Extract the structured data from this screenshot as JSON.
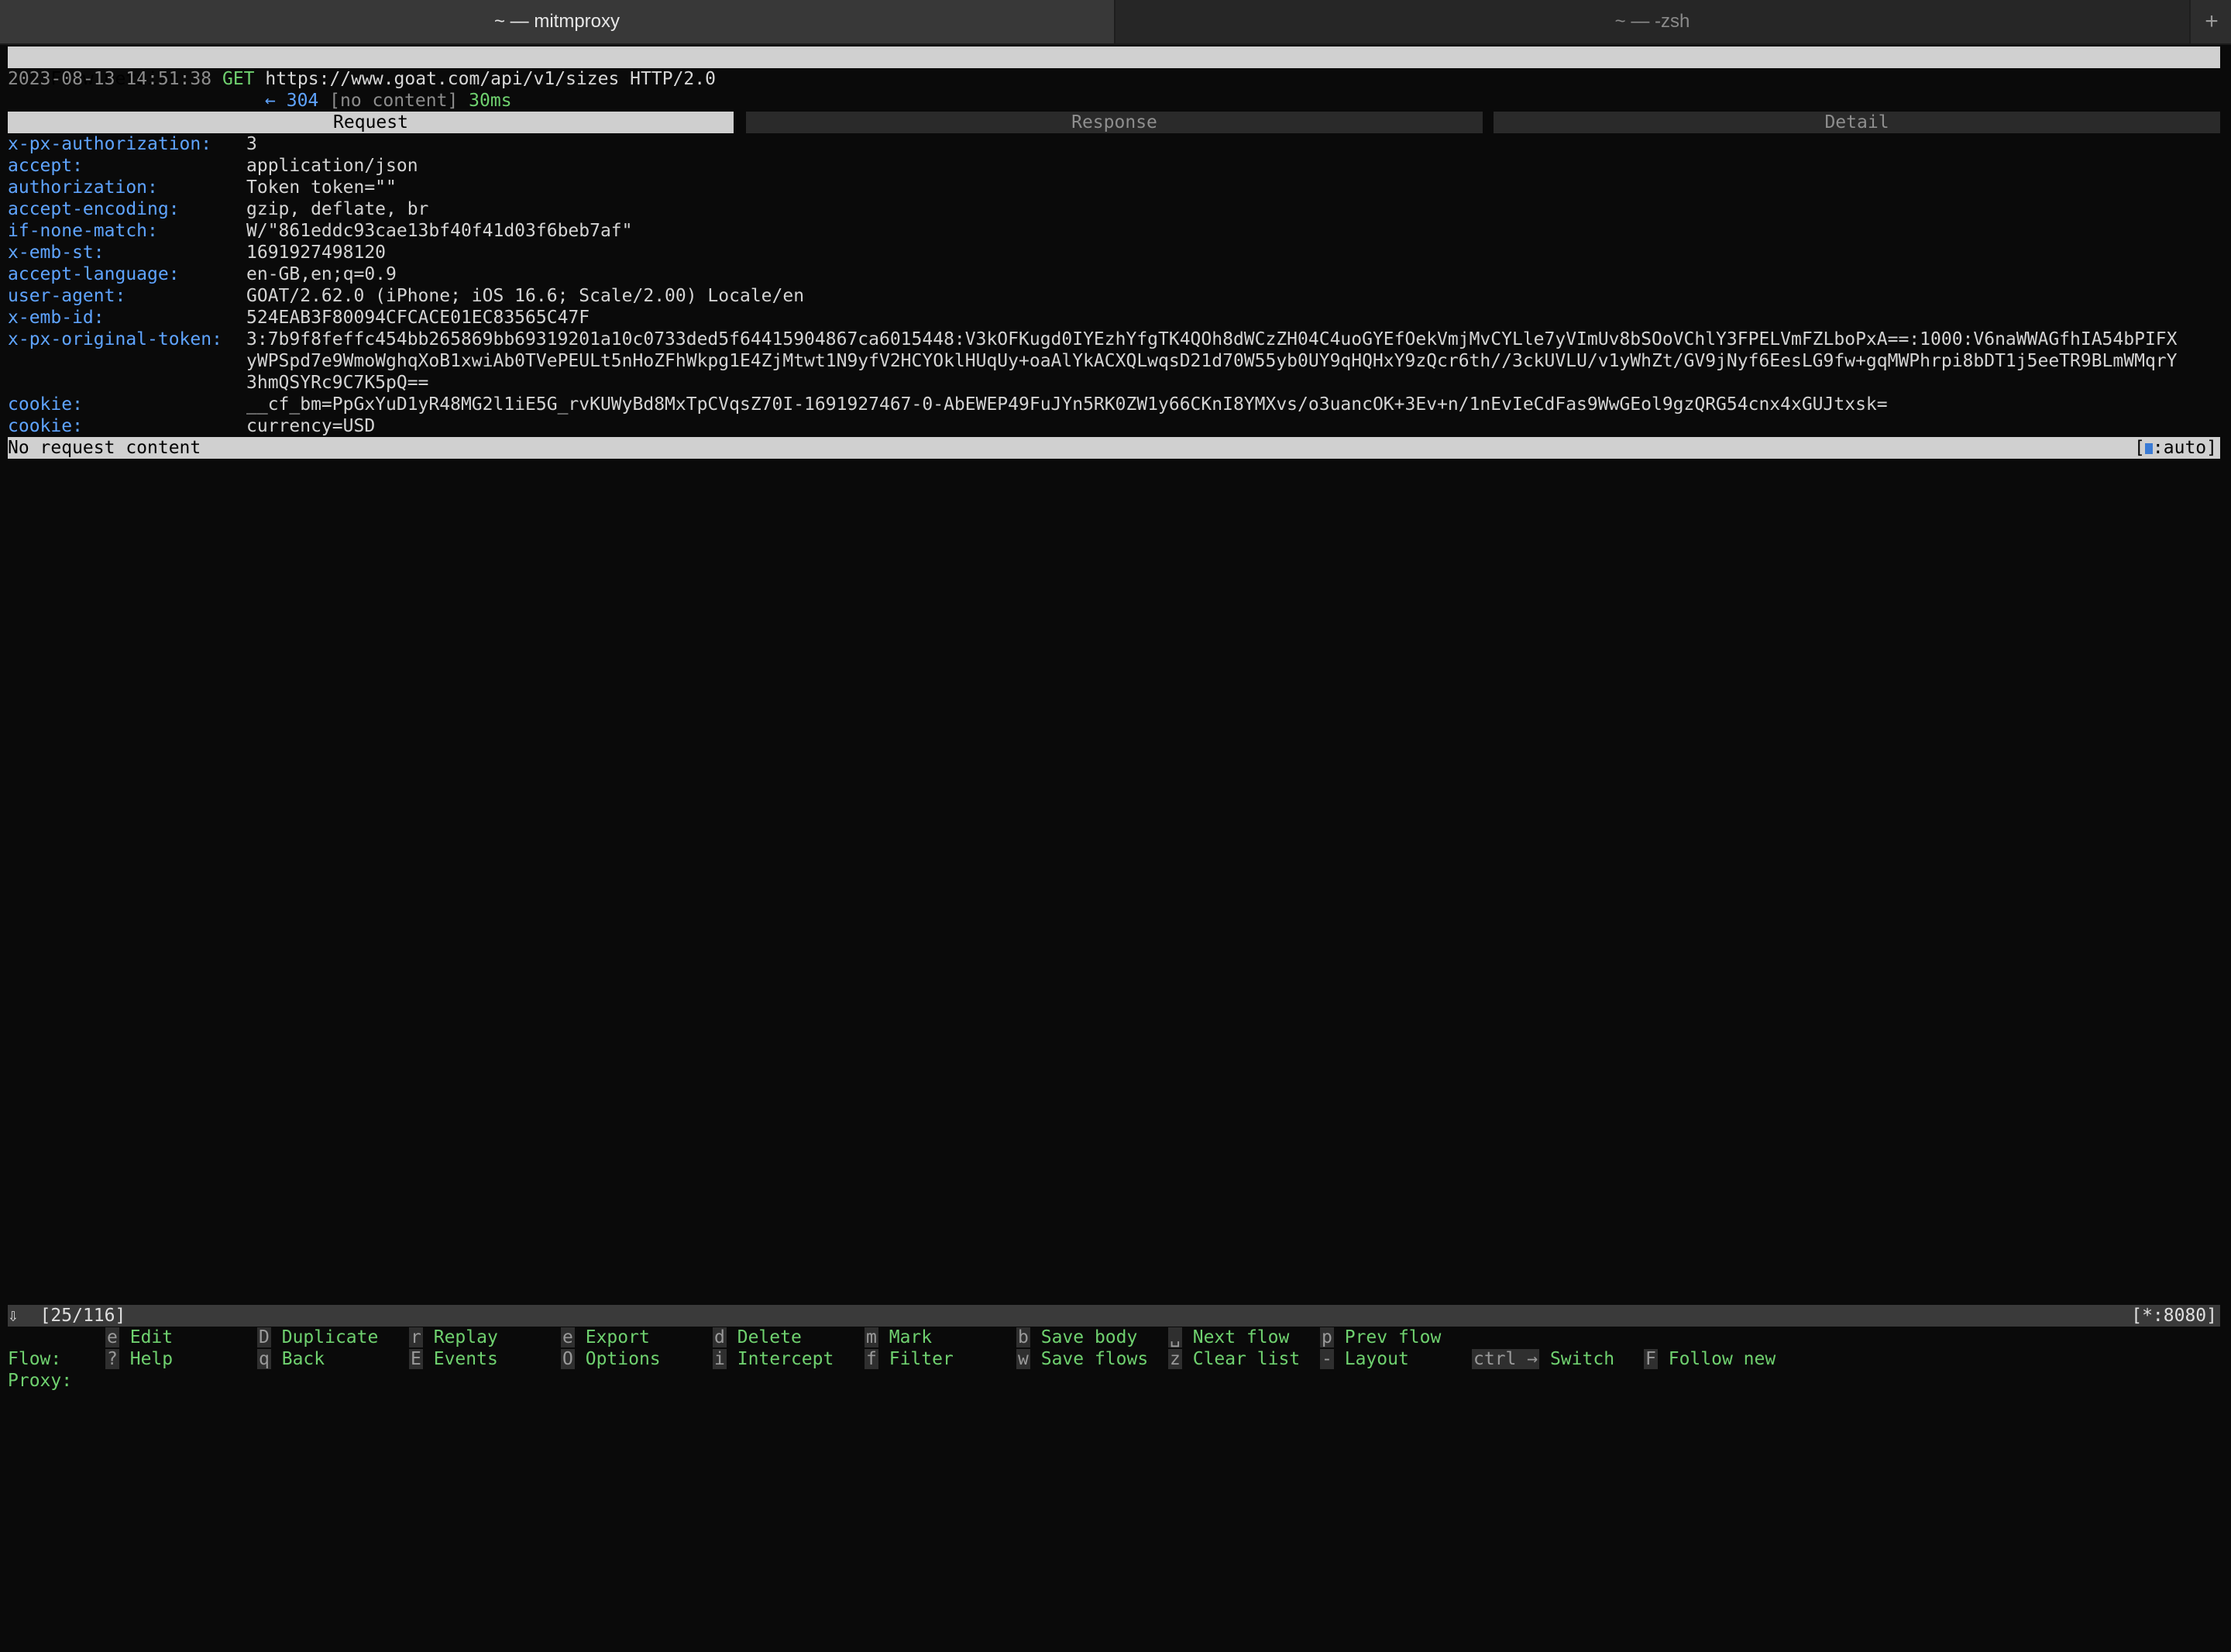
{
  "window": {
    "tabs": [
      {
        "label": "~ — mitmproxy",
        "active": true
      },
      {
        "label": "~ — -zsh",
        "active": false
      }
    ],
    "add_tab_icon": "plus-icon"
  },
  "flow": {
    "section_title": "Flow Details",
    "timestamp": "2023-08-13 14:51:38",
    "method": "GET",
    "url": "https://www.goat.com/api/v1/sizes HTTP/2.0",
    "response_arrow": "←",
    "status_code": "304",
    "status_text": "[no content]",
    "duration": "30ms"
  },
  "panel_tabs": [
    {
      "label": "Request",
      "active": true
    },
    {
      "label": "Response",
      "active": false
    },
    {
      "label": "Detail",
      "active": false
    }
  ],
  "headers": [
    {
      "key": "x-px-authorization:",
      "value": "3"
    },
    {
      "key": "accept:",
      "value": "application/json"
    },
    {
      "key": "authorization:",
      "value": "Token token=\"\""
    },
    {
      "key": "accept-encoding:",
      "value": "gzip, deflate, br"
    },
    {
      "key": "if-none-match:",
      "value": "W/\"861eddc93cae13bf40f41d03f6beb7af\""
    },
    {
      "key": "x-emb-st:",
      "value": "1691927498120"
    },
    {
      "key": "accept-language:",
      "value": "en-GB,en;q=0.9"
    },
    {
      "key": "user-agent:",
      "value": "GOAT/2.62.0 (iPhone; iOS 16.6; Scale/2.00) Locale/en"
    },
    {
      "key": "x-emb-id:",
      "value": "524EAB3F80094CFCACE01EC83565C47F"
    },
    {
      "key": "x-px-original-token:",
      "value": "3:7b9f8feffc454bb265869bb69319201a10c0733ded5f64415904867ca6015448:V3kOFKugd0IYEzhYfgTK4QOh8dWCzZH04C4uoGYEfOekVmjMvCYLle7yVImUv8bSOoVChlY3FPELVmFZLboPxA==:1000:V6naWWAGfhIA54bPIFX"
    },
    {
      "key": "",
      "value": "yWPSpd7e9WmoWghqXoB1xwiAb0TVePEULt5nHoZFhWkpg1E4ZjMtwt1N9yfV2HCYOklHUqUy+oaAlYkACXQLwqsD21d70W55yb0UY9qHQHxY9zQcr6th//3ckUVLU/v1yWhZt/GV9jNyf6EesLG9fw+gqMWPhrpi8bDT1j5eeTR9BLmWMqrY"
    },
    {
      "key": "",
      "value": "3hmQSYRc9C7K5pQ=="
    },
    {
      "key": "cookie:",
      "value": "__cf_bm=PpGxYuD1yR48MG2l1iE5G_rvKUWyBd8MxTpCVqsZ70I-1691927467-0-AbEWEP49FuJYn5RK0ZW1y66CKnI8YMXvs/o3uancOK+3Ev+n/1nEvIeCdFas9WwGEol9gzQRG54cnx4xGUJtxsk="
    },
    {
      "key": "cookie:",
      "value": "currency=USD"
    }
  ],
  "content_bar": {
    "text": "No request content",
    "mode": ":auto]",
    "mode_prefix": "["
  },
  "status_bar": {
    "arrow": "⇩",
    "position": "[25/116]",
    "listen": "[*:8080]"
  },
  "keybindings": {
    "flow_label": "Flow:",
    "proxy_label": "Proxy:",
    "flow": [
      {
        "key": "e",
        "label": "Edit"
      },
      {
        "key": "D",
        "label": "Duplicate"
      },
      {
        "key": "r",
        "label": "Replay"
      },
      {
        "key": "e",
        "label": "Export"
      },
      {
        "key": "d",
        "label": "Delete"
      },
      {
        "key": "m",
        "label": "Mark"
      },
      {
        "key": "b",
        "label": "Save body"
      },
      {
        "key": "␣",
        "label": "Next flow"
      },
      {
        "key": "p",
        "label": "Prev flow"
      }
    ],
    "proxy": [
      {
        "key": "?",
        "label": "Help"
      },
      {
        "key": "q",
        "label": "Back"
      },
      {
        "key": "E",
        "label": "Events"
      },
      {
        "key": "O",
        "label": "Options"
      },
      {
        "key": "i",
        "label": "Intercept"
      },
      {
        "key": "f",
        "label": "Filter"
      },
      {
        "key": "w",
        "label": "Save flows"
      },
      {
        "key": "z",
        "label": "Clear list"
      },
      {
        "key": "-",
        "label": "Layout"
      },
      {
        "key": "ctrl →",
        "label": "Switch"
      },
      {
        "key": "F",
        "label": "Follow new"
      }
    ]
  }
}
